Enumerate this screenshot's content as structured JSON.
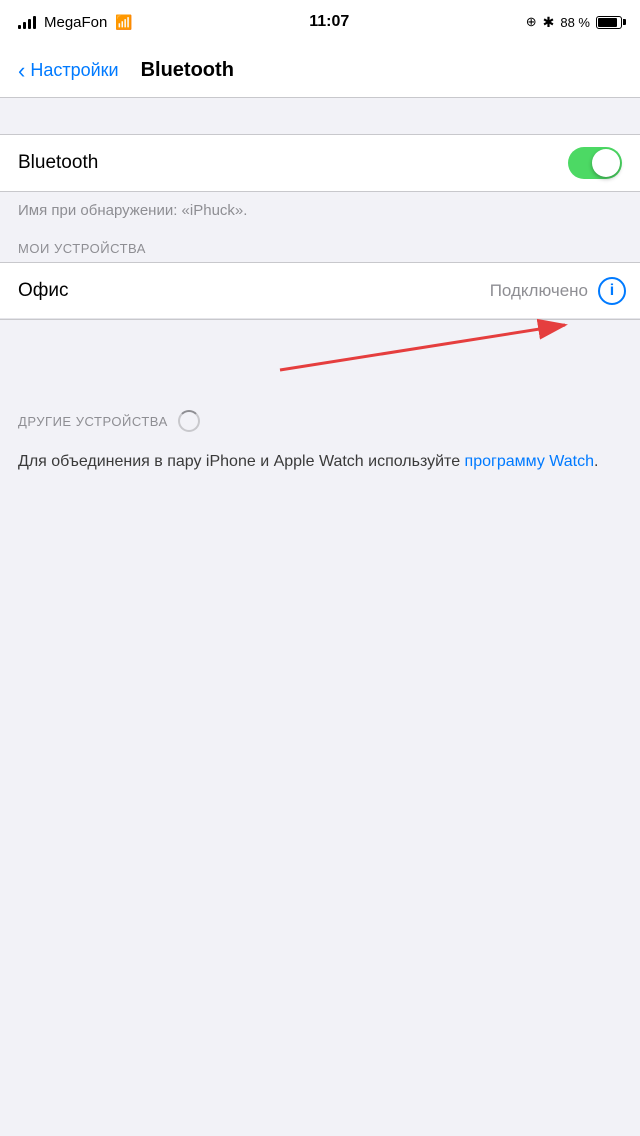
{
  "status": {
    "carrier": "MegaFon",
    "time": "11:07",
    "battery_pct": "88 %",
    "icons": {
      "location": "@",
      "bluetooth": "*"
    }
  },
  "nav": {
    "back_label": "Настройки",
    "title": "Bluetooth"
  },
  "bluetooth": {
    "label": "Bluetooth",
    "toggle_on": true,
    "discovery_note": "Имя при обнаружении: «iPhuck».",
    "my_devices_header": "МОИ УСТРОЙСТВА",
    "device": {
      "name": "Офис",
      "status": "Подключено"
    },
    "other_devices_header": "ДРУГИЕ УСТРОЙСТВА",
    "watch_note_part1": "Для объединения в пару iPhone и Apple Watch используйте ",
    "watch_note_link": "программу Watch",
    "watch_note_part2": "."
  }
}
